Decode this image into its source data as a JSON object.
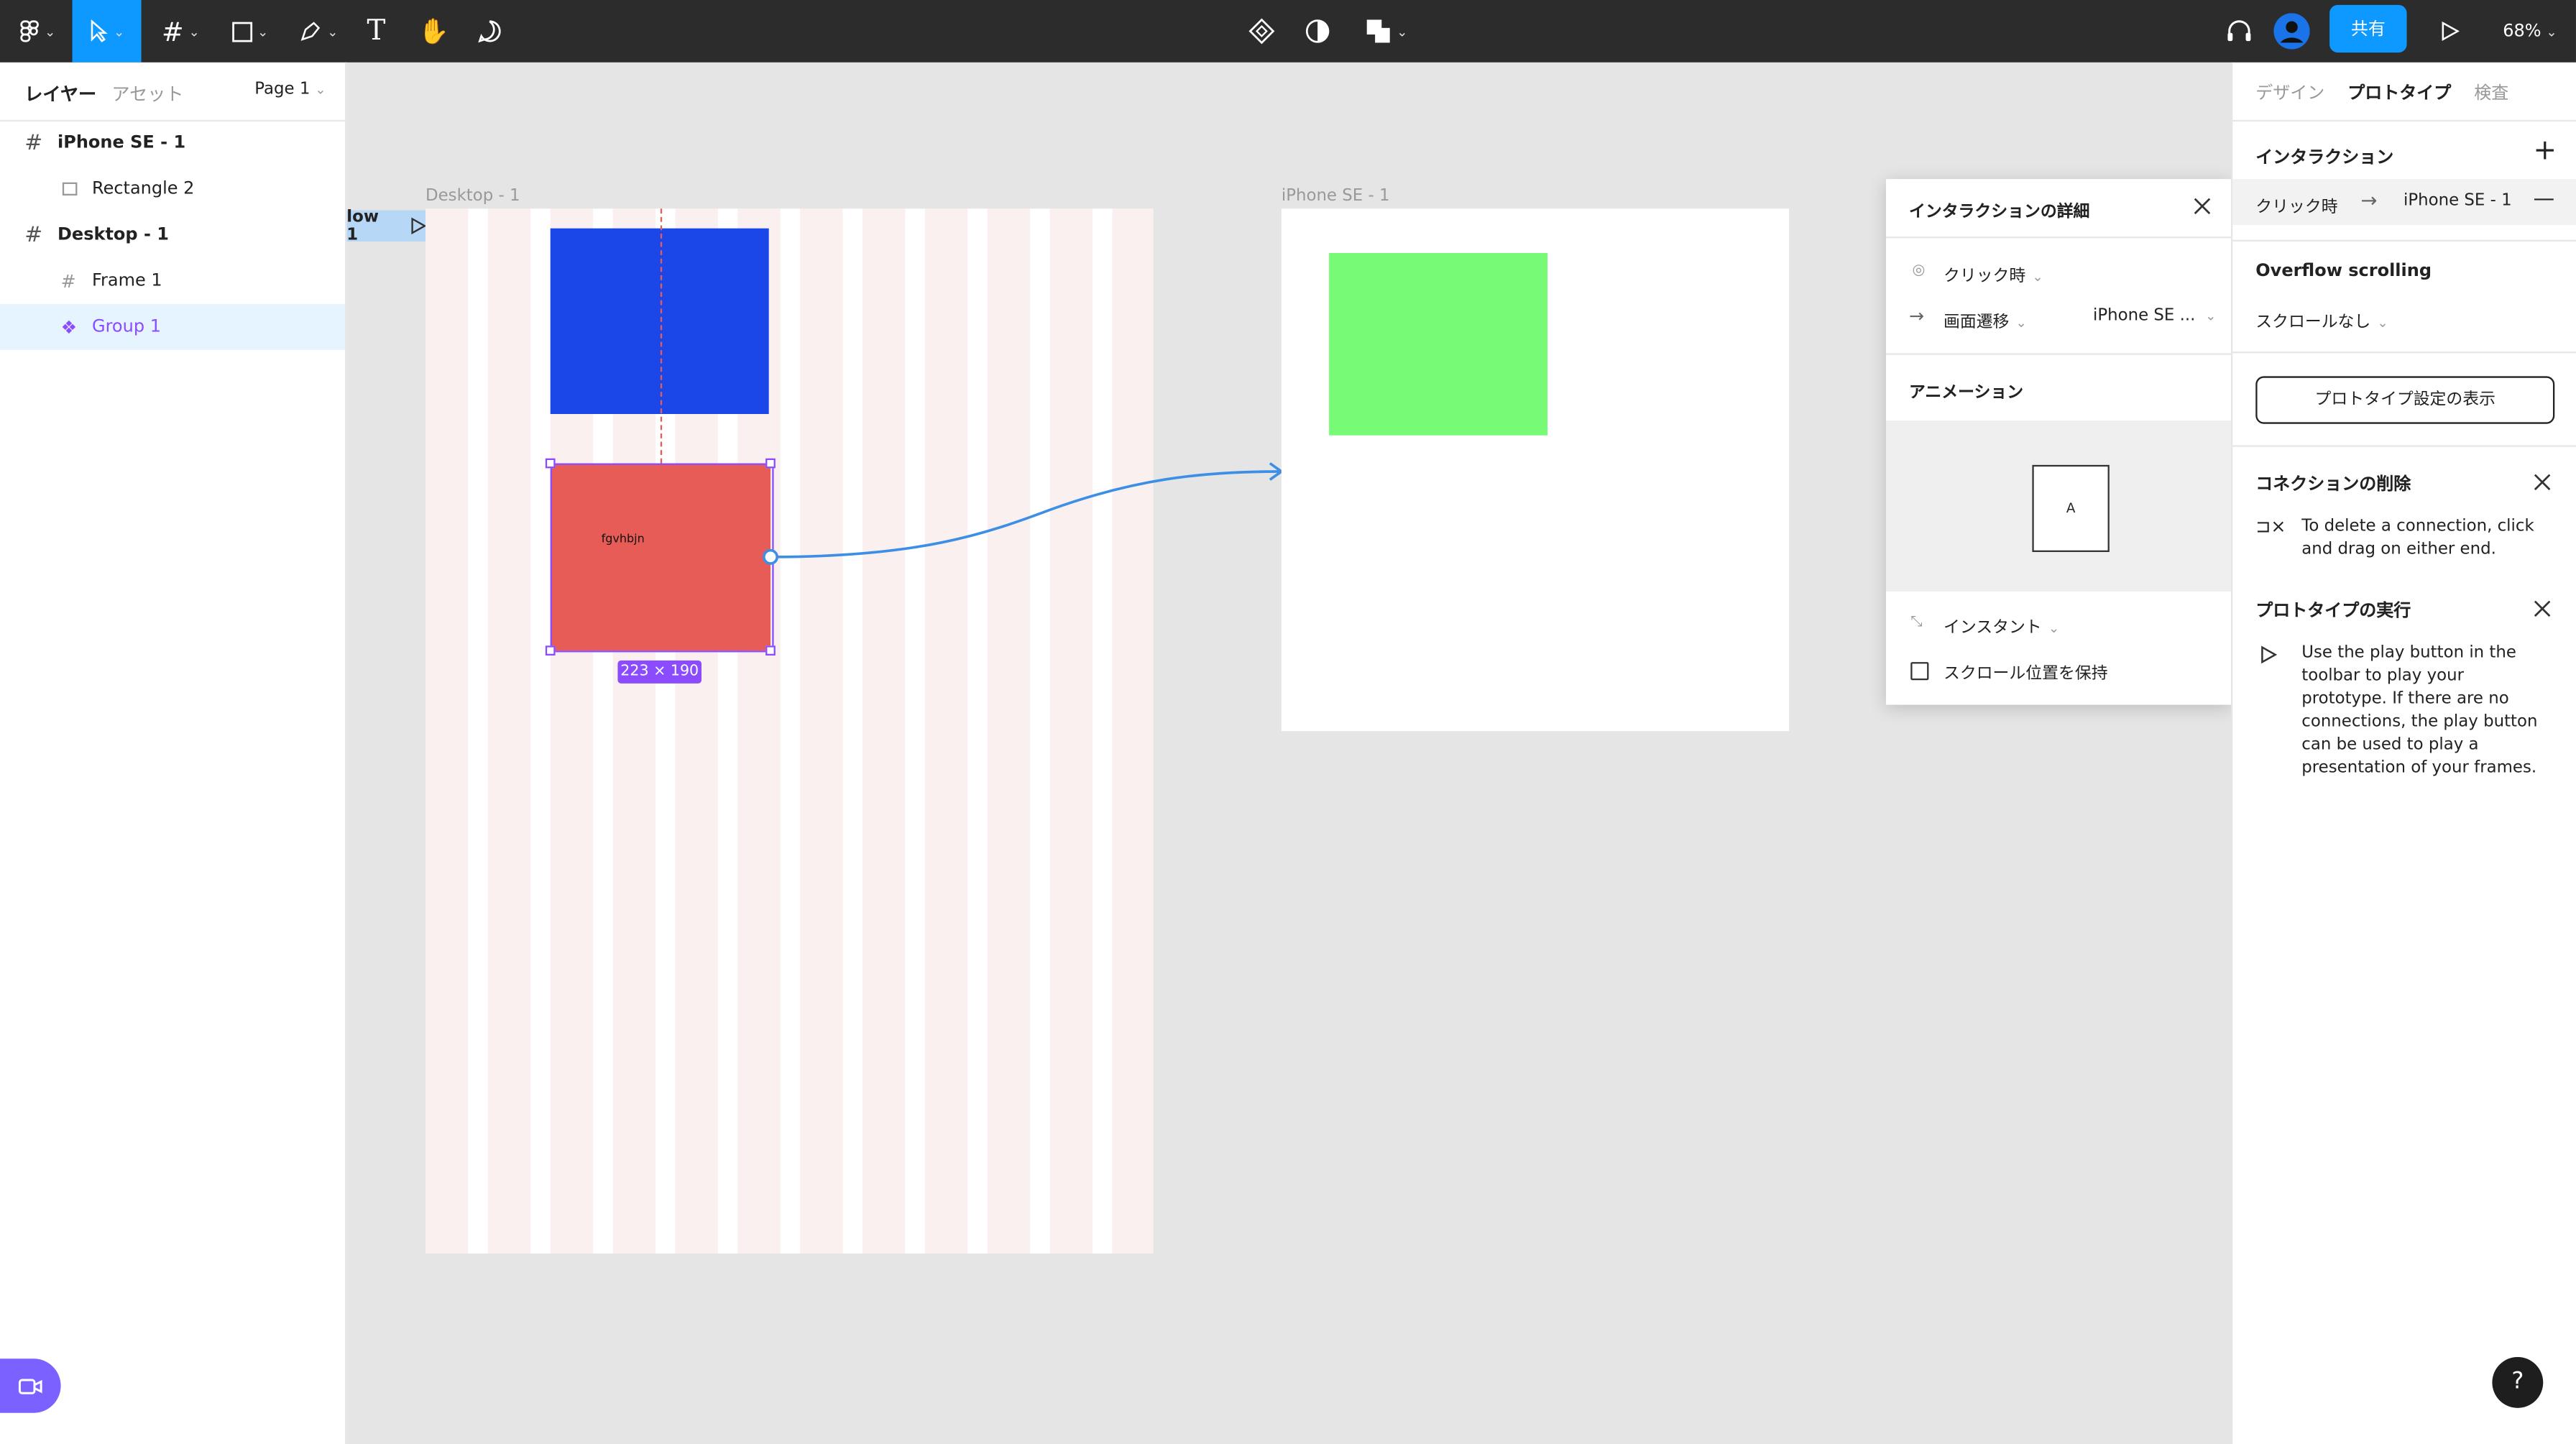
{
  "toolbar": {
    "zoom": "68%",
    "share_label": "共有"
  },
  "left_panel": {
    "tab_layers": "レイヤー",
    "tab_assets": "アセット",
    "page_selector": "Page 1",
    "layers": [
      {
        "label": "iPhone SE - 1"
      },
      {
        "label": "Rectangle 2"
      },
      {
        "label": "Desktop - 1"
      },
      {
        "label": "Frame 1"
      },
      {
        "label": "Group 1"
      }
    ]
  },
  "canvas": {
    "flow_label": "low 1",
    "desktop_frame_label": "Desktop - 1",
    "iphone_frame_label": "iPhone SE - 1",
    "red_rect_text": "fgvhbjn",
    "size_badge": "223 × 190",
    "colors": {
      "blue": "#1b47e8",
      "red": "#e85c57",
      "green": "#77fb77",
      "selection": "#8b4bff",
      "connector": "#3d8fe6"
    }
  },
  "popup": {
    "title": "インタラクションの詳細",
    "trigger": "クリック時",
    "action": "画面遷移",
    "destination": "iPhone SE ...",
    "animation_title": "アニメーション",
    "preview_letter": "A",
    "animation_type": "インスタント",
    "preserve_scroll": "スクロール位置を保持"
  },
  "right_panel": {
    "tab_design": "デザイン",
    "tab_prototype": "プロトタイプ",
    "tab_inspect": "検査",
    "interaction_title": "インタラクション",
    "interaction_trigger": "クリック時",
    "interaction_target": "iPhone SE - 1",
    "overflow_title": "Overflow scrolling",
    "overflow_value": "スクロールなし",
    "show_settings_button": "プロトタイプ設定の表示",
    "delete_connection_title": "コネクションの削除",
    "delete_connection_text": "To delete a connection, click and drag on either end.",
    "run_prototype_title": "プロトタイプの実行",
    "run_prototype_text": "Use the play button in the toolbar to play your prototype. If there are no connections, the play button can be used to play a presentation of your frames."
  },
  "help_label": "?"
}
